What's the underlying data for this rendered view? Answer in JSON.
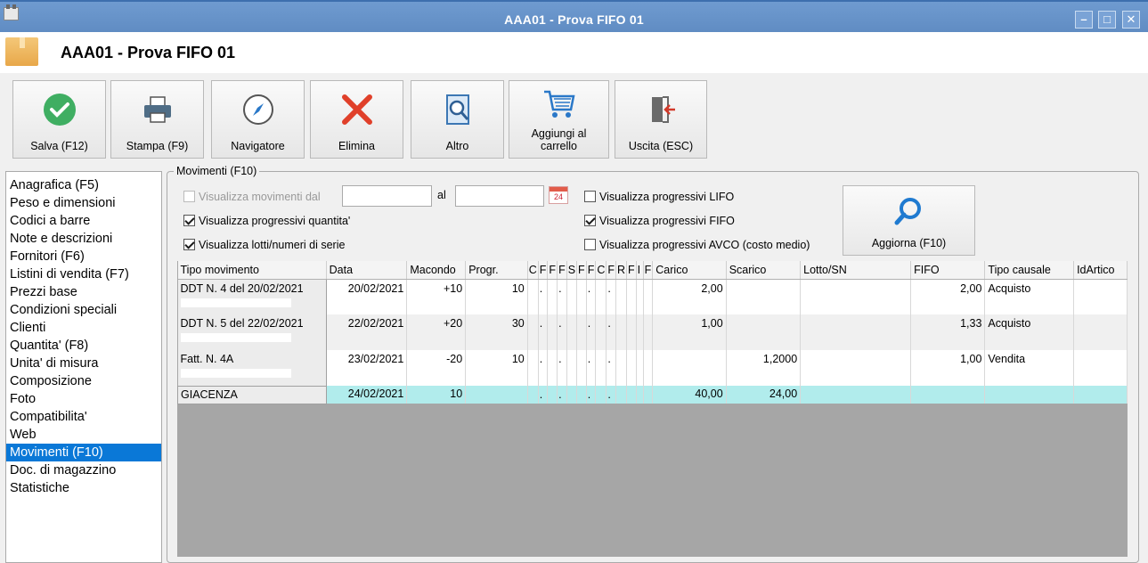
{
  "window": {
    "title": "AAA01 - Prova FIFO 01"
  },
  "header": {
    "title": "AAA01 - Prova FIFO 01"
  },
  "toolbar": [
    {
      "id": "save",
      "label": "Salva (F12)"
    },
    {
      "id": "print",
      "label": "Stampa (F9)"
    },
    {
      "id": "navigator",
      "label": "Navigatore"
    },
    {
      "id": "delete",
      "label": "Elimina"
    },
    {
      "id": "other",
      "label": "Altro"
    },
    {
      "id": "cart",
      "label": "Aggiungi al\ncarrello"
    },
    {
      "id": "exit",
      "label": "Uscita (ESC)"
    }
  ],
  "nav": {
    "items": [
      "Anagrafica (F5)",
      "Peso e dimensioni",
      "Codici a barre",
      "Note e descrizioni",
      "Fornitori (F6)",
      "Listini di vendita (F7)",
      "Prezzi base",
      "Condizioni speciali",
      "Clienti",
      "Quantita' (F8)",
      "Unita' di misura",
      "Composizione",
      "Foto",
      "Compatibilita'",
      "Web",
      "Movimenti (F10)",
      "Doc. di magazzino",
      "Statistiche"
    ],
    "selected_index": 15
  },
  "movements": {
    "group_title": "Movimenti (F10)",
    "show_from_label": "Visualizza movimenti dal",
    "to_label": "al",
    "from_value": "",
    "to_value": "",
    "calendar_day": "24",
    "show_qty_progressive": "Visualizza progressivi quantita'",
    "show_lots": "Visualizza lotti/numeri di serie",
    "show_lifo": "Visualizza progressivi LIFO",
    "show_fifo": "Visualizza progressivi FIFO",
    "show_avco": "Visualizza progressivi AVCO (costo medio)",
    "refresh_label": "Aggiorna (F10)"
  },
  "grid": {
    "columns": [
      "Tipo movimento",
      "Data",
      "Macondo",
      "Progr.",
      "C",
      "F",
      "F",
      "F",
      "S",
      "F",
      "F",
      "C",
      "F",
      "R",
      "F",
      "I",
      "F",
      "Carico",
      "Scarico",
      "Lotto/SN",
      "FIFO",
      "Tipo causale",
      "IdArtico"
    ],
    "rows": [
      {
        "tipo": "DDT N. 4 del 20/02/2021",
        "data": "20/02/2021",
        "macondo": "+10",
        "progr": "10",
        "carico": "2,00",
        "scarico": "",
        "lotto": "",
        "fifo": "2,00",
        "causale": "Acquisto"
      },
      {
        "tipo": "DDT N. 5 del 22/02/2021",
        "data": "22/02/2021",
        "macondo": "+20",
        "progr": "30",
        "carico": "1,00",
        "scarico": "",
        "lotto": "",
        "fifo": "1,33",
        "causale": "Acquisto"
      },
      {
        "tipo": "Fatt. N. 4A",
        "data": "23/02/2021",
        "macondo": "-20",
        "progr": "10",
        "carico": "",
        "scarico": "1,2000",
        "lotto": "",
        "fifo": "1,00",
        "causale": "Vendita"
      }
    ],
    "total": {
      "tipo": "GIACENZA",
      "data": "24/02/2021",
      "macondo": "10",
      "progr": "",
      "carico": "40,00",
      "scarico": "24,00"
    },
    "dot": "."
  }
}
